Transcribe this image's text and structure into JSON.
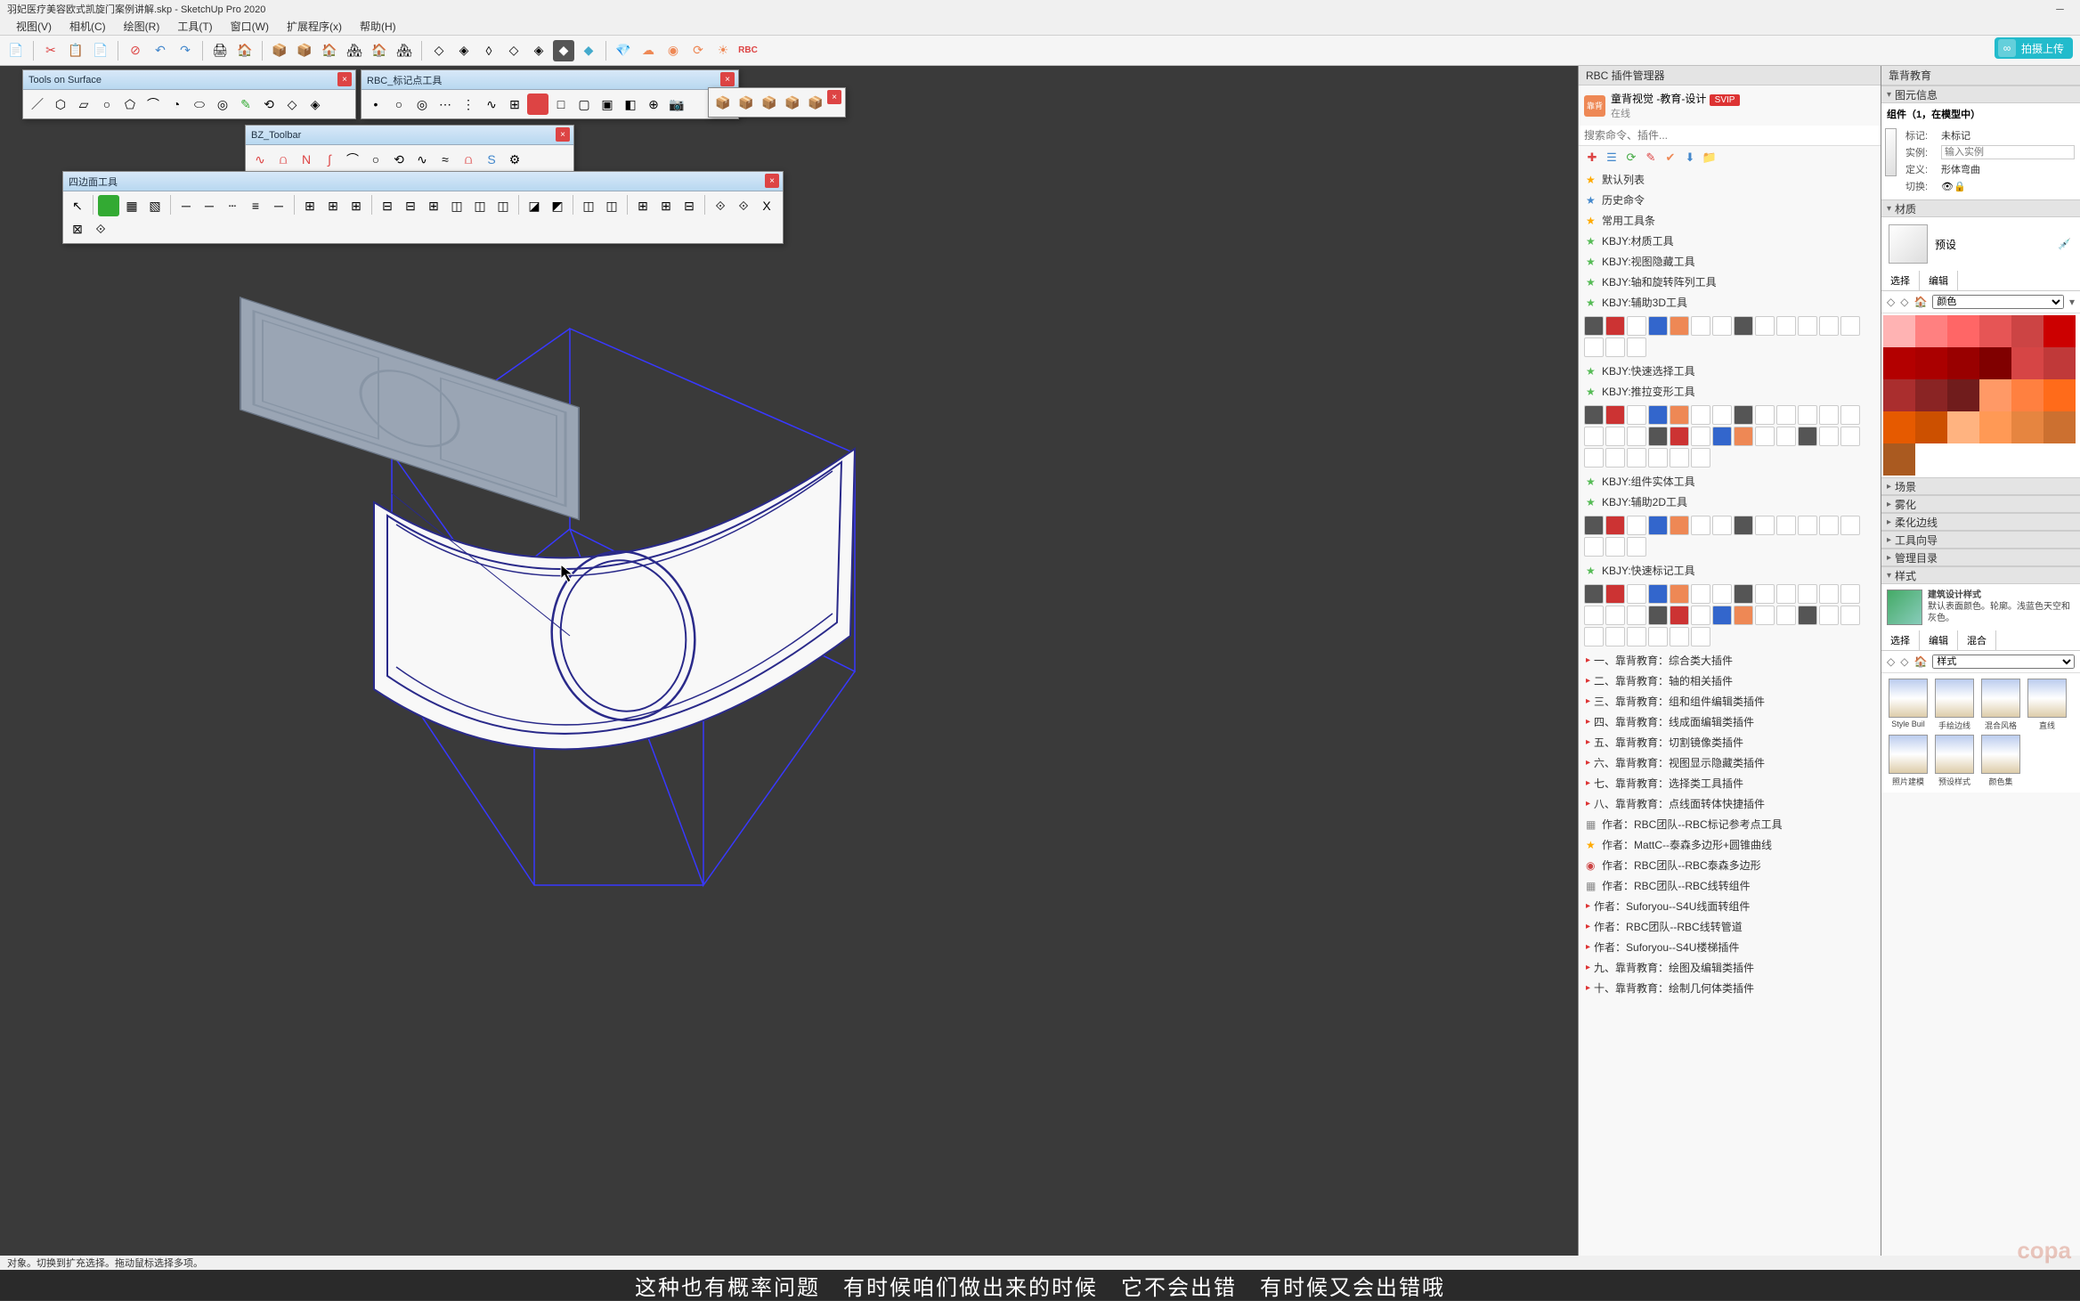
{
  "title": "羽妃医疗美容欧式凯旋门案例讲解.skp - SketchUp Pro 2020",
  "menu": [
    "视图(V)",
    "相机(C)",
    "绘图(R)",
    "工具(T)",
    "窗口(W)",
    "扩展程序(x)",
    "帮助(H)"
  ],
  "upload_label": "拍摄上传",
  "floaters": {
    "tools_on_surface": {
      "title": "Tools on Surface"
    },
    "rbc": {
      "title": "RBC_标记点工具"
    },
    "bz": {
      "title": "BZ_Toolbar"
    },
    "poly": {
      "title": "四边面工具"
    }
  },
  "plugin_panel": {
    "title": "RBC 插件管理器",
    "user": "童背视觉 -教育-设计",
    "badge": "SVIP",
    "status": "在线",
    "search_placeholder": "搜索命令、插件...",
    "items": [
      {
        "icon": "star",
        "label": "默认列表"
      },
      {
        "icon": "bstar",
        "label": "历史命令"
      },
      {
        "icon": "star",
        "label": "常用工具条"
      },
      {
        "icon": "gstar",
        "label": "KBJY:材质工具"
      },
      {
        "icon": "gstar",
        "label": "KBJY:视图隐藏工具"
      },
      {
        "icon": "gstar",
        "label": "KBJY:轴和旋转阵列工具"
      },
      {
        "icon": "gstar",
        "label": "KBJY:辅助3D工具"
      },
      {
        "icon": "gstar",
        "label": "KBJY:快速选择工具"
      },
      {
        "icon": "gstar",
        "label": "KBJY:推拉变形工具"
      },
      {
        "icon": "gstar",
        "label": "KBJY:组件实体工具"
      },
      {
        "icon": "gstar",
        "label": "KBJY:辅助2D工具"
      },
      {
        "icon": "gstar",
        "label": "KBJY:快速标记工具"
      },
      {
        "icon": "arr",
        "label": "一、靠背教育：综合类大插件"
      },
      {
        "icon": "arr",
        "label": "二、靠背教育：轴的相关插件"
      },
      {
        "icon": "arr",
        "label": "三、靠背教育：组和组件编辑类插件"
      },
      {
        "icon": "arr",
        "label": "四、靠背教育：线成面编辑类插件"
      },
      {
        "icon": "arr",
        "label": "五、靠背教育：切割镜像类插件"
      },
      {
        "icon": "arr",
        "label": "六、靠背教育：视图显示隐藏类插件"
      },
      {
        "icon": "arr",
        "label": "七、靠背教育：选择类工具插件"
      },
      {
        "icon": "arr",
        "label": "八、靠背教育：点线面转体快捷插件"
      },
      {
        "icon": "sq",
        "label": "作者：RBC团队--RBC标记参考点工具"
      },
      {
        "icon": "star",
        "label": "作者：MattC--泰森多边形+圆锥曲线"
      },
      {
        "icon": "dot",
        "label": "作者：RBC团队--RBC泰森多边形"
      },
      {
        "icon": "sq",
        "label": "作者：RBC团队--RBC线转组件"
      },
      {
        "icon": "arr",
        "label": "作者：Suforyou--S4U线面转组件"
      },
      {
        "icon": "arr",
        "label": "作者：RBC团队--RBC线转管道"
      },
      {
        "icon": "arr",
        "label": "作者：Suforyou--S4U楼梯插件"
      },
      {
        "icon": "arr",
        "label": "九、靠背教育：绘图及编辑类插件"
      },
      {
        "icon": "arr",
        "label": "十、靠背教育：绘制几何体类插件"
      }
    ]
  },
  "right_panel": {
    "title": "靠背教育",
    "sections": {
      "entity": {
        "title": "图元信息",
        "sub": "组件（1，在模型中）",
        "tag_label": "标记:",
        "tag_value": "未标记",
        "instance_label": "实例:",
        "instance_placeholder": "输入实例",
        "def_label": "定义:",
        "def_value": "形体弯曲",
        "toggle_label": "切换:"
      },
      "material": {
        "title": "材质",
        "preset": "预设"
      },
      "scene": {
        "title": "场景"
      },
      "fog": {
        "title": "雾化"
      },
      "softedge": {
        "title": "柔化边线"
      },
      "guide": {
        "title": "工具向导"
      },
      "catalog": {
        "title": "管理目录"
      },
      "style": {
        "title": "样式",
        "name": "建筑设计样式",
        "desc": "默认表面颜色。轮廓。浅蓝色天空和灰色。"
      }
    },
    "tabs": [
      "选择",
      "编辑"
    ],
    "color_tabs": [
      "选择",
      "编辑",
      "混合"
    ],
    "color_nav": "颜色",
    "style_nav": "样式",
    "styles": [
      "Style Buil",
      "手绘边线",
      "混合风格",
      "直线",
      "照片建模",
      "预设样式",
      "颜色集"
    ]
  },
  "status": "对象。切换到扩充选择。拖动鼠标选择多项。",
  "subtitle": "这种也有概率问题　有时候咱们做出来的时候　它不会出错　有时候又会出错哦",
  "colors": [
    "#ffb3b3",
    "#ff8080",
    "#ff6666",
    "#e65555",
    "#cc4444",
    "#cc0000",
    "#b30000",
    "#aa0000",
    "#990000",
    "#800000",
    "#d64545",
    "#c03939",
    "#aa2e2e",
    "#8a2424",
    "#701c1c",
    "#ff9966",
    "#ff8040",
    "#ff6b1a",
    "#e65a00",
    "#cc5000",
    "#ffb380",
    "#ff9955",
    "#e68540",
    "#cc7030",
    "#aa5a20"
  ]
}
